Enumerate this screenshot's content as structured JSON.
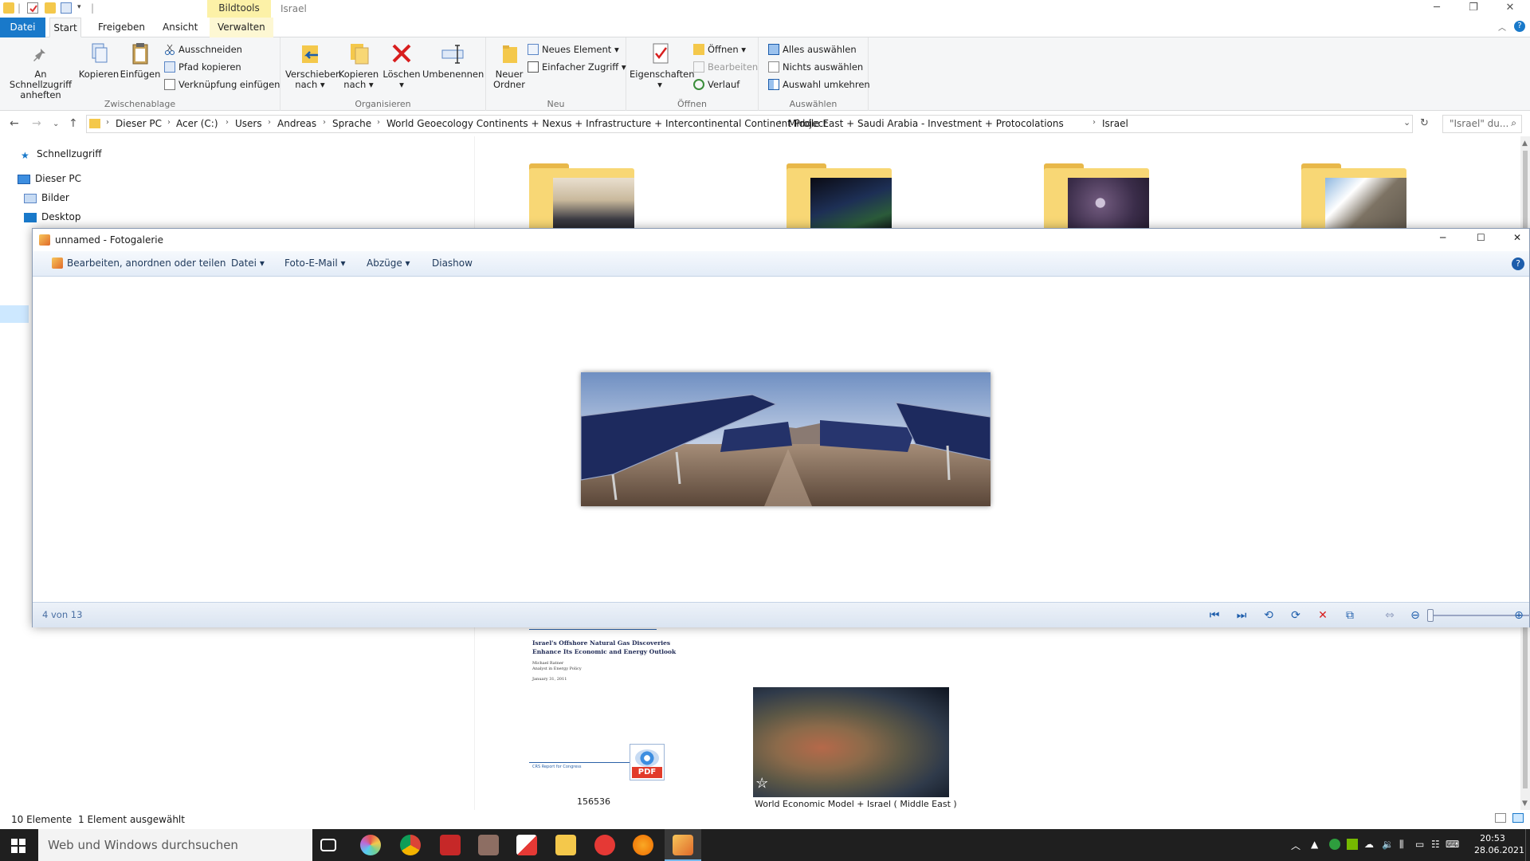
{
  "titlebar": {
    "context_tab": "Bildtools",
    "window_title": "Israel"
  },
  "ribbon_tabs": [
    "Datei",
    "Start",
    "Freigeben",
    "Ansicht",
    "Verwalten"
  ],
  "ribbon": {
    "clipboard": {
      "label": "Zwischenablage",
      "pin": "An Schnellzugriff anheften",
      "copy": "Kopieren",
      "paste": "Einfügen",
      "cut": "Ausschneiden",
      "copy_path": "Pfad kopieren",
      "paste_shortcut": "Verknüpfung einfügen"
    },
    "organize": {
      "label": "Organisieren",
      "move_to": "Verschieben nach",
      "copy_to": "Kopieren nach",
      "delete": "Löschen",
      "rename": "Umbenennen"
    },
    "new": {
      "label": "Neu",
      "new_folder": "Neuer Ordner",
      "new_item": "Neues Element",
      "easy_access": "Einfacher Zugriff"
    },
    "open": {
      "label": "Öffnen",
      "properties": "Eigenschaften",
      "open": "Öffnen",
      "edit": "Bearbeiten",
      "history": "Verlauf"
    },
    "select": {
      "label": "Auswählen",
      "select_all": "Alles auswählen",
      "select_none": "Nichts auswählen",
      "invert": "Auswahl umkehren"
    }
  },
  "address": {
    "crumbs": [
      "Dieser PC",
      "Acer (C:)",
      "Users",
      "Andreas",
      "Sprache",
      "World Geoecology Continents + Nexus + Infrastructure + Intercontinental Continent Project",
      "Middle East + Saudi Arabia - Investment + Protocolations",
      "Israel"
    ],
    "search_placeholder": "\"Israel\" du..."
  },
  "navpane": {
    "quick_access": "Schnellzugriff",
    "this_pc": "Dieser PC",
    "pictures": "Bilder",
    "desktop": "Desktop"
  },
  "content": {
    "doc_title_line1": "Israel's Offshore Natural Gas Discoveries",
    "doc_title_line2": "Enhance Its Economic and Energy Outlook",
    "doc_author": "Michael Ratner",
    "doc_role": "Analyst in Energy Policy",
    "doc_date": "January 31, 2011",
    "doc_footer": "CRS Report for Congress",
    "pdf_label": "PDF",
    "file1_name": "156536",
    "file2_name": "World Economic Model + Israel ( Middle East )"
  },
  "status": {
    "count": "10 Elemente",
    "selected": "1 Element ausgewählt"
  },
  "gallery": {
    "title": "unnamed - Fotogalerie",
    "menu": [
      "Bearbeiten, anordnen oder teilen",
      "Datei",
      "Foto-E-Mail",
      "Abzüge",
      "Diashow"
    ],
    "counter": "4 von 13"
  },
  "taskbar": {
    "search_placeholder": "Web und Windows durchsuchen",
    "time": "20:53",
    "date": "28.06.2021"
  },
  "colors": {
    "file_tab": "#1979ca",
    "context_tab": "#fcf1a7",
    "folder": "#f8d775",
    "taskbar": "#1f1f1f",
    "gallery_accent": "#1d5dab"
  }
}
